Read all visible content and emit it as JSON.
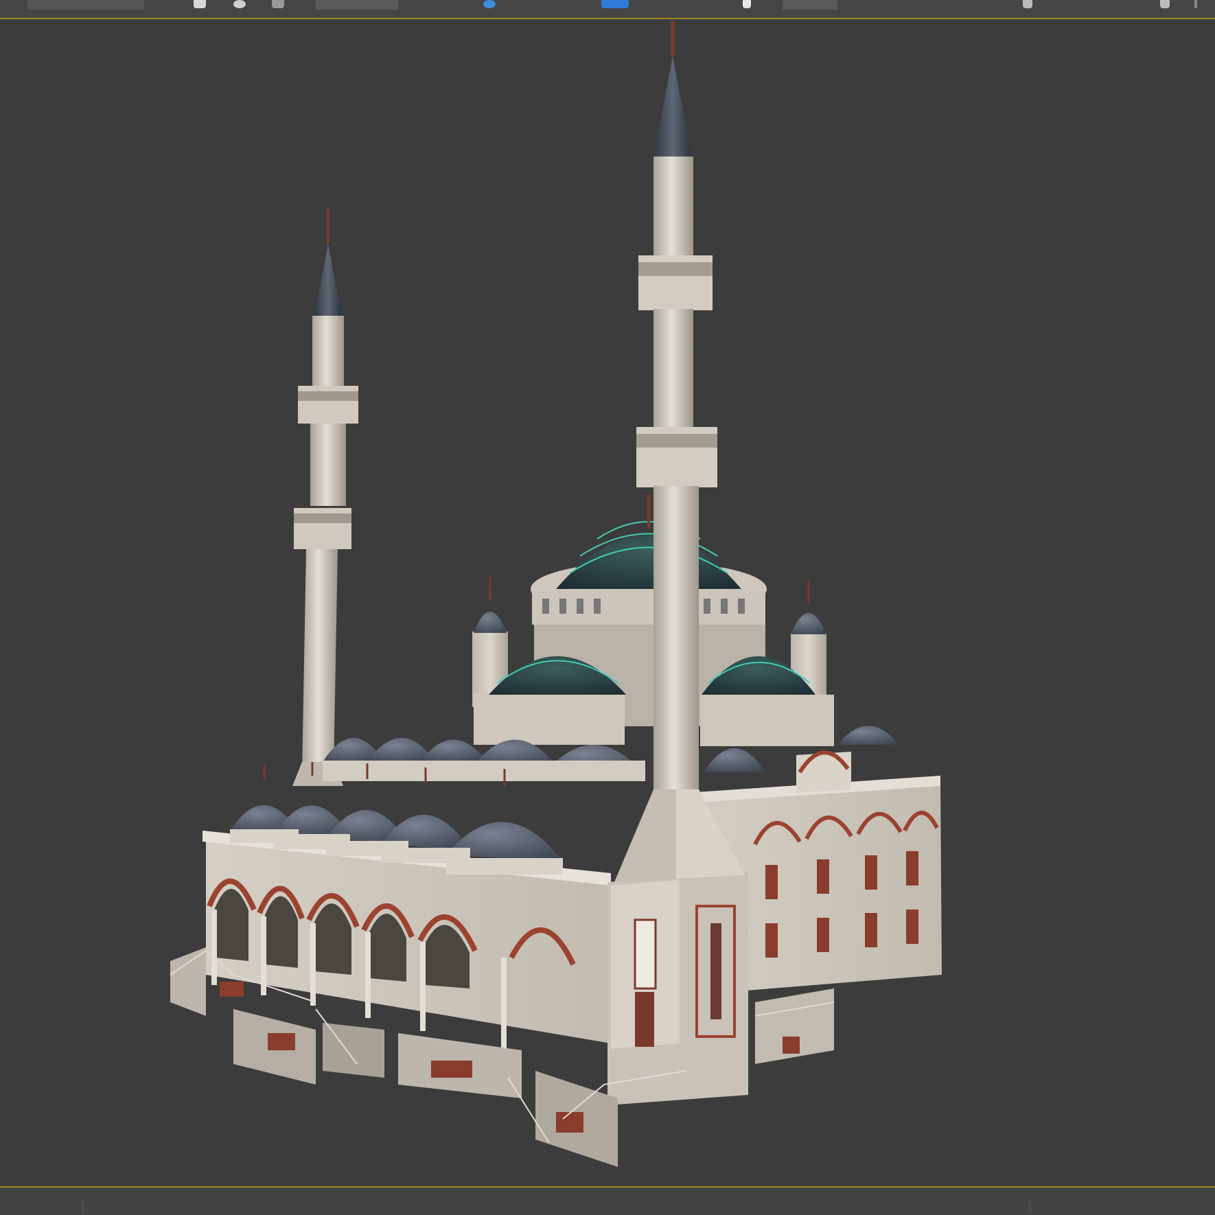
{
  "app": {
    "accent_color": "#a08a2a",
    "viewport_background": "#3c3c3c"
  },
  "toolbar": {
    "items": [
      {
        "icon": "menu-icon"
      },
      {
        "icon": "select-icon"
      },
      {
        "icon": "move-icon"
      },
      {
        "icon": "snap-icon"
      },
      {
        "icon": "selection-filter-icon"
      },
      {
        "icon": "active-toggle-icon"
      },
      {
        "icon": "viewport-active-icon"
      },
      {
        "icon": "pointer-icon"
      },
      {
        "icon": "maximize-icon"
      },
      {
        "icon": "zoom-icon"
      }
    ]
  },
  "viewport": {
    "content": "mosque-3d-model",
    "shading": "shaded-with-edges"
  }
}
